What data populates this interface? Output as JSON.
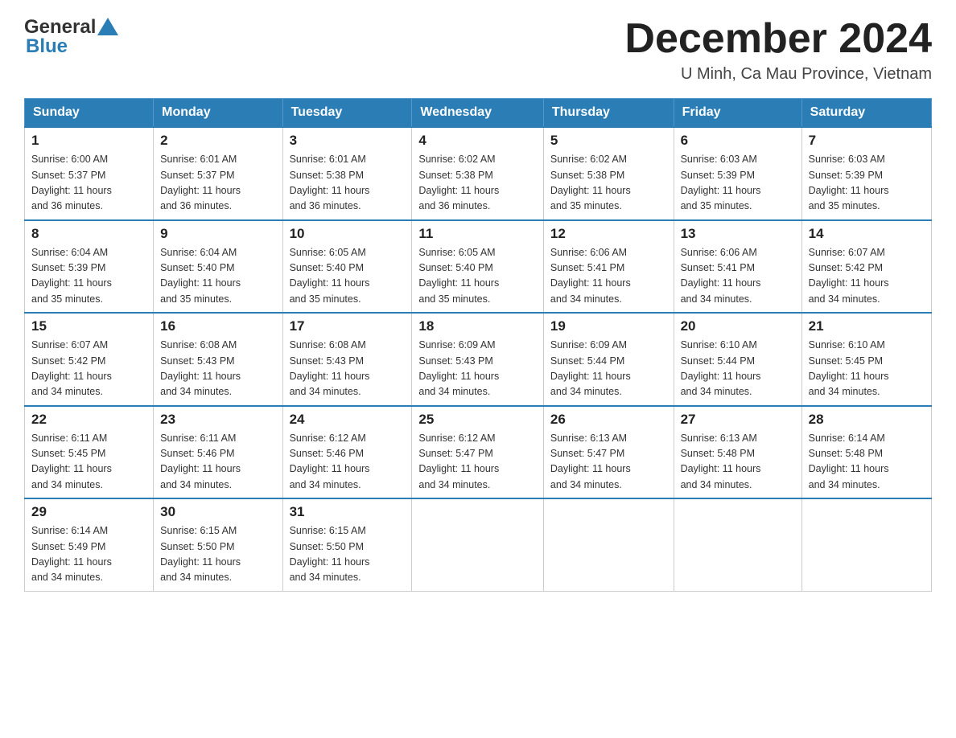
{
  "header": {
    "logo_general": "General",
    "logo_blue": "Blue",
    "month_title": "December 2024",
    "location": "U Minh, Ca Mau Province, Vietnam"
  },
  "weekdays": [
    "Sunday",
    "Monday",
    "Tuesday",
    "Wednesday",
    "Thursday",
    "Friday",
    "Saturday"
  ],
  "weeks": [
    [
      {
        "day": "1",
        "sunrise": "6:00 AM",
        "sunset": "5:37 PM",
        "daylight": "11 hours and 36 minutes."
      },
      {
        "day": "2",
        "sunrise": "6:01 AM",
        "sunset": "5:37 PM",
        "daylight": "11 hours and 36 minutes."
      },
      {
        "day": "3",
        "sunrise": "6:01 AM",
        "sunset": "5:38 PM",
        "daylight": "11 hours and 36 minutes."
      },
      {
        "day": "4",
        "sunrise": "6:02 AM",
        "sunset": "5:38 PM",
        "daylight": "11 hours and 36 minutes."
      },
      {
        "day": "5",
        "sunrise": "6:02 AM",
        "sunset": "5:38 PM",
        "daylight": "11 hours and 35 minutes."
      },
      {
        "day": "6",
        "sunrise": "6:03 AM",
        "sunset": "5:39 PM",
        "daylight": "11 hours and 35 minutes."
      },
      {
        "day": "7",
        "sunrise": "6:03 AM",
        "sunset": "5:39 PM",
        "daylight": "11 hours and 35 minutes."
      }
    ],
    [
      {
        "day": "8",
        "sunrise": "6:04 AM",
        "sunset": "5:39 PM",
        "daylight": "11 hours and 35 minutes."
      },
      {
        "day": "9",
        "sunrise": "6:04 AM",
        "sunset": "5:40 PM",
        "daylight": "11 hours and 35 minutes."
      },
      {
        "day": "10",
        "sunrise": "6:05 AM",
        "sunset": "5:40 PM",
        "daylight": "11 hours and 35 minutes."
      },
      {
        "day": "11",
        "sunrise": "6:05 AM",
        "sunset": "5:40 PM",
        "daylight": "11 hours and 35 minutes."
      },
      {
        "day": "12",
        "sunrise": "6:06 AM",
        "sunset": "5:41 PM",
        "daylight": "11 hours and 34 minutes."
      },
      {
        "day": "13",
        "sunrise": "6:06 AM",
        "sunset": "5:41 PM",
        "daylight": "11 hours and 34 minutes."
      },
      {
        "day": "14",
        "sunrise": "6:07 AM",
        "sunset": "5:42 PM",
        "daylight": "11 hours and 34 minutes."
      }
    ],
    [
      {
        "day": "15",
        "sunrise": "6:07 AM",
        "sunset": "5:42 PM",
        "daylight": "11 hours and 34 minutes."
      },
      {
        "day": "16",
        "sunrise": "6:08 AM",
        "sunset": "5:43 PM",
        "daylight": "11 hours and 34 minutes."
      },
      {
        "day": "17",
        "sunrise": "6:08 AM",
        "sunset": "5:43 PM",
        "daylight": "11 hours and 34 minutes."
      },
      {
        "day": "18",
        "sunrise": "6:09 AM",
        "sunset": "5:43 PM",
        "daylight": "11 hours and 34 minutes."
      },
      {
        "day": "19",
        "sunrise": "6:09 AM",
        "sunset": "5:44 PM",
        "daylight": "11 hours and 34 minutes."
      },
      {
        "day": "20",
        "sunrise": "6:10 AM",
        "sunset": "5:44 PM",
        "daylight": "11 hours and 34 minutes."
      },
      {
        "day": "21",
        "sunrise": "6:10 AM",
        "sunset": "5:45 PM",
        "daylight": "11 hours and 34 minutes."
      }
    ],
    [
      {
        "day": "22",
        "sunrise": "6:11 AM",
        "sunset": "5:45 PM",
        "daylight": "11 hours and 34 minutes."
      },
      {
        "day": "23",
        "sunrise": "6:11 AM",
        "sunset": "5:46 PM",
        "daylight": "11 hours and 34 minutes."
      },
      {
        "day": "24",
        "sunrise": "6:12 AM",
        "sunset": "5:46 PM",
        "daylight": "11 hours and 34 minutes."
      },
      {
        "day": "25",
        "sunrise": "6:12 AM",
        "sunset": "5:47 PM",
        "daylight": "11 hours and 34 minutes."
      },
      {
        "day": "26",
        "sunrise": "6:13 AM",
        "sunset": "5:47 PM",
        "daylight": "11 hours and 34 minutes."
      },
      {
        "day": "27",
        "sunrise": "6:13 AM",
        "sunset": "5:48 PM",
        "daylight": "11 hours and 34 minutes."
      },
      {
        "day": "28",
        "sunrise": "6:14 AM",
        "sunset": "5:48 PM",
        "daylight": "11 hours and 34 minutes."
      }
    ],
    [
      {
        "day": "29",
        "sunrise": "6:14 AM",
        "sunset": "5:49 PM",
        "daylight": "11 hours and 34 minutes."
      },
      {
        "day": "30",
        "sunrise": "6:15 AM",
        "sunset": "5:50 PM",
        "daylight": "11 hours and 34 minutes."
      },
      {
        "day": "31",
        "sunrise": "6:15 AM",
        "sunset": "5:50 PM",
        "daylight": "11 hours and 34 minutes."
      },
      null,
      null,
      null,
      null
    ]
  ],
  "labels": {
    "sunrise": "Sunrise:",
    "sunset": "Sunset:",
    "daylight": "Daylight:"
  }
}
